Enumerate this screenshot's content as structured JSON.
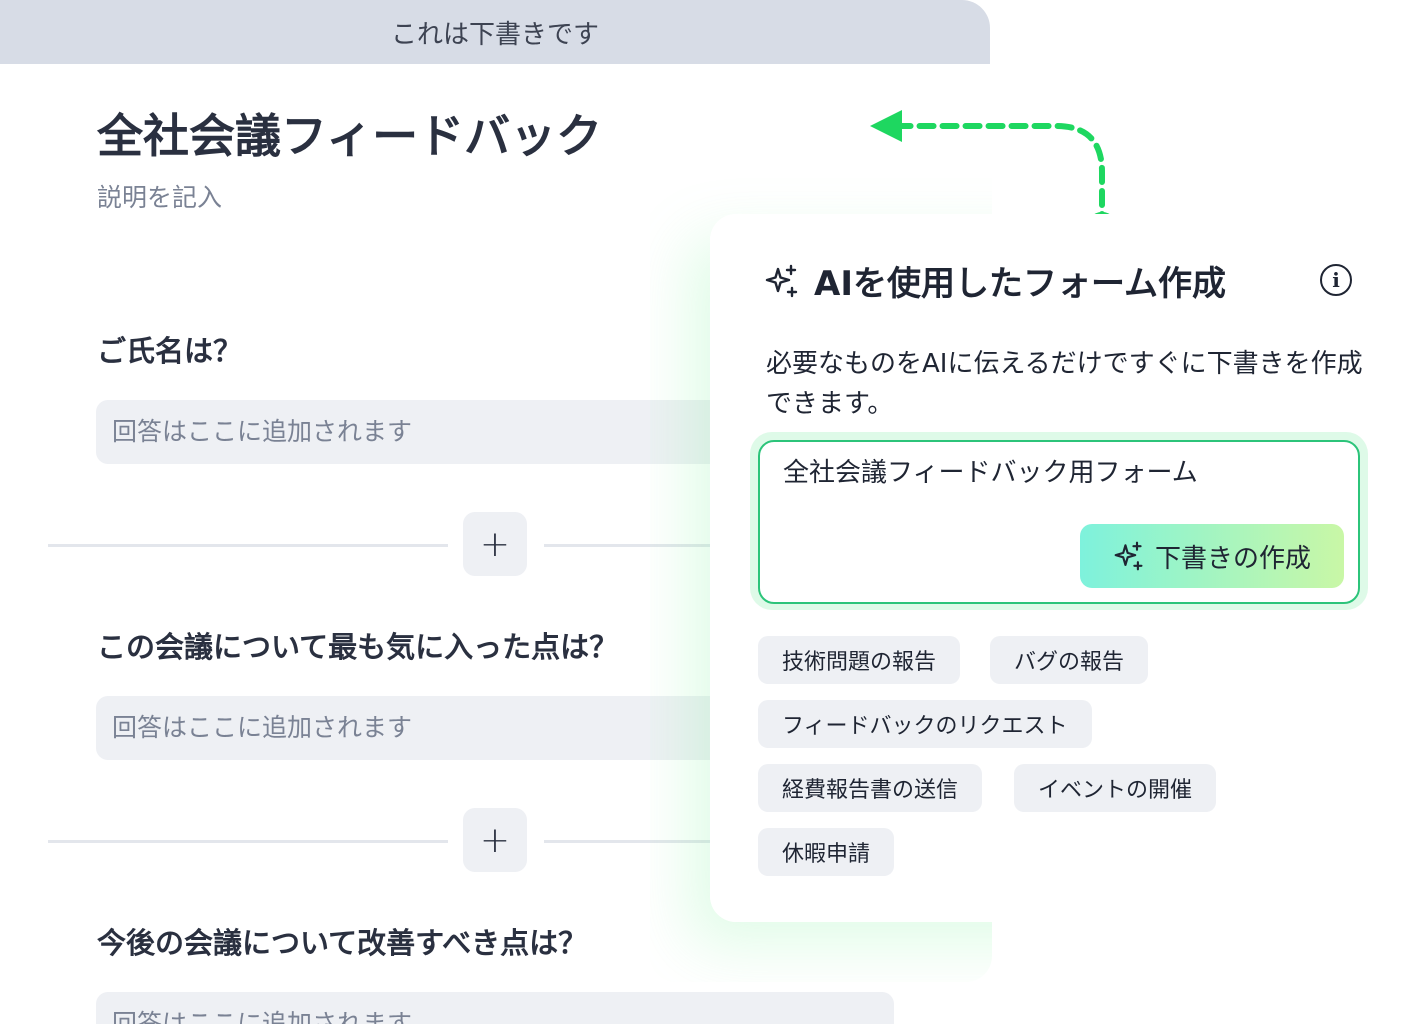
{
  "banner": {
    "text": "これは下書きです"
  },
  "form": {
    "title": "全社会議フィードバック",
    "description_placeholder": "説明を記入",
    "questions": [
      {
        "label": "ご氏名は？",
        "answer_placeholder": "回答はここに追加されます"
      },
      {
        "label": "この会議について最も気に入った点は？",
        "answer_placeholder": "回答はここに追加されます"
      },
      {
        "label": "今後の会議について改善すべき点は？",
        "answer_placeholder": "回答はここに追加されます"
      }
    ],
    "add_button_label": "+"
  },
  "ai_panel": {
    "title": "AIを使用したフォーム作成",
    "info_icon": "i",
    "description": "必要なものをAIに伝えるだけですぐに下書きを作成できます。",
    "prompt_value": "全社会議フィードバック用フォーム",
    "create_button_label": "下書きの作成",
    "suggestions": [
      "技術問題の報告",
      "バグの報告",
      "フィードバックのリクエスト",
      "経費報告書の送信",
      "イベントの開催",
      "休暇申請"
    ]
  },
  "colors": {
    "accent_green": "#2cc47a",
    "arrow_green": "#1ed760",
    "banner_bg": "#d7dce6",
    "button_gradient_start": "#7ef2dc",
    "button_gradient_end": "#c9f7a6"
  },
  "icons": {
    "sparkle": "sparkle-icon",
    "info": "info-icon",
    "plus": "plus-icon",
    "arrow": "dashed-arrow-icon"
  }
}
